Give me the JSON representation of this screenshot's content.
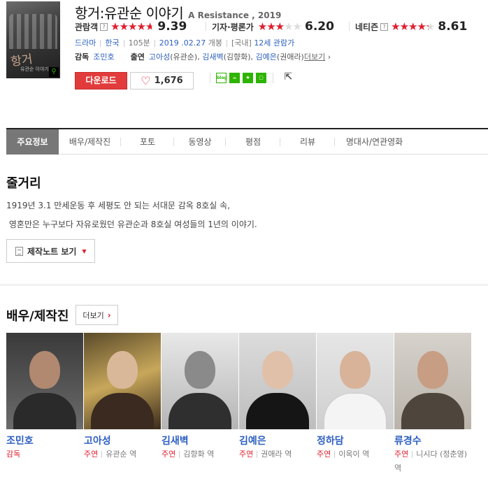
{
  "movie": {
    "title_kr": "항거:유관순 이야기",
    "title_en": "A Resistance , 2019",
    "poster_title": "항거",
    "poster_sub": "유관순 이야기"
  },
  "ratings": [
    {
      "label": "관람객",
      "score": "9.39",
      "fill": 0.939,
      "help": true
    },
    {
      "label": "기자·평론가",
      "score": "6.20",
      "fill": 0.62,
      "help": false
    },
    {
      "label": "네티즌",
      "score": "8.61",
      "fill": 0.861,
      "help": true
    }
  ],
  "stars_glyph": "★★★★★",
  "help_glyph": "?",
  "meta": {
    "genre": "드라마",
    "country": "한국",
    "runtime": "105분",
    "release_date": "2019 .02.27",
    "release_suffix": "개봉",
    "grade_prefix": "[국내]",
    "grade": "12세 관람가"
  },
  "people": {
    "director_label": "감독",
    "director": "조민호",
    "cast_label": "출연",
    "cast": [
      {
        "name": "고아성",
        "role": "(유관순)"
      },
      {
        "name": "김새벽",
        "role": "(김향화)"
      },
      {
        "name": "김예은",
        "role": "(권애라)"
      }
    ],
    "more": "더보기",
    "more_arrow": "›"
  },
  "actions": {
    "download": "다운로드",
    "like_count": "1,676",
    "heart": "♡",
    "share_blog": "blog",
    "share_out": "⇱"
  },
  "tabs": [
    "주요정보",
    "배우/제작진",
    "포토",
    "동영상",
    "평점",
    "리뷰",
    "명대사/연관영화"
  ],
  "synopsis": {
    "heading": "줄거리",
    "lines": [
      "1919년 3.1 만세운동 후 세평도 안 되는 서대문 감옥 8호실 속,",
      " 영혼만은 누구보다 자유로웠던 유관순과 8호실 여성들의 1년의 이야기."
    ],
    "note_button": "제작노트 보기",
    "note_caret": "▼"
  },
  "cast_section": {
    "heading": "배우/제작진",
    "more": "더보기",
    "more_arrow": "›",
    "members": [
      {
        "name": "조민호",
        "position": "감독",
        "role": ""
      },
      {
        "name": "고아성",
        "position": "주연",
        "role": "유관순 역"
      },
      {
        "name": "김새벽",
        "position": "주연",
        "role": "김향화 역"
      },
      {
        "name": "김예은",
        "position": "주연",
        "role": "권애라 역"
      },
      {
        "name": "정하담",
        "position": "주연",
        "role": "이옥이 역"
      },
      {
        "name": "류경수",
        "position": "주연",
        "role": "니시다 (정춘영) 역"
      }
    ]
  },
  "colors": {
    "accent_red": "#e01e2e",
    "link_blue": "#2c5fc1",
    "tab_active": "#777777"
  }
}
